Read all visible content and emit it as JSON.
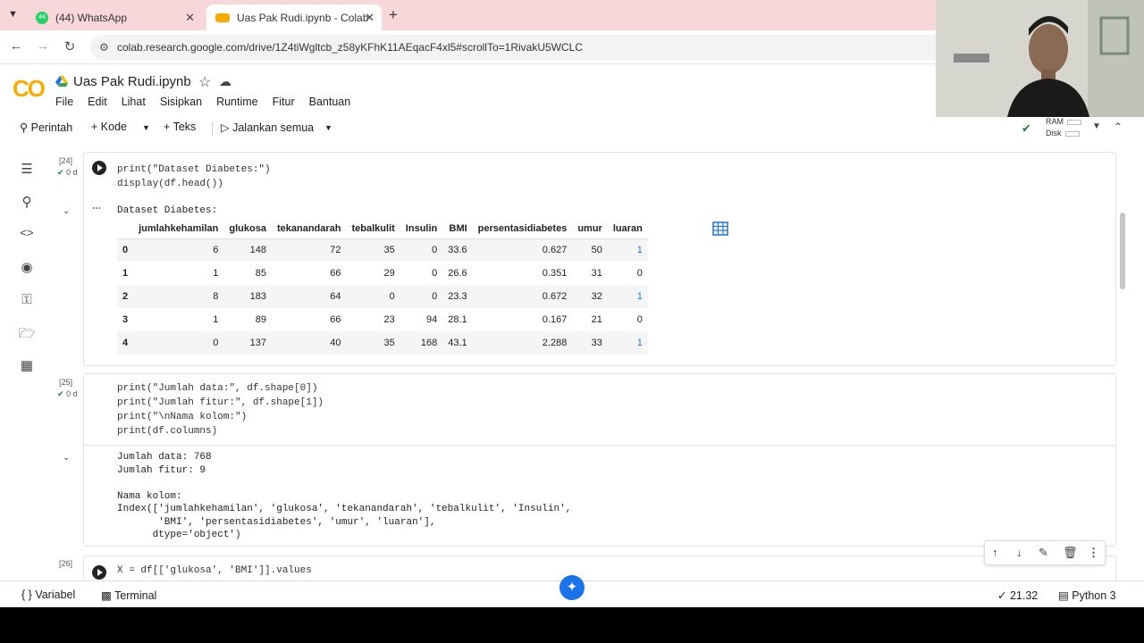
{
  "browser": {
    "tabs": [
      {
        "label": "(44) WhatsApp",
        "badge": "44",
        "active": false
      },
      {
        "label": "Uas Pak Rudi.ipynb - Colab",
        "active": true
      }
    ],
    "url": "colab.research.google.com/drive/1Z4tiWgltcb_z58yKFhK11AEqacF4xl5#scrollTo=1RivakU5WCLC"
  },
  "colab": {
    "logo": "CO",
    "title": "Uas Pak Rudi.ipynb",
    "menu": [
      "File",
      "Edit",
      "Lihat",
      "Sisipkan",
      "Runtime",
      "Fitur",
      "Bantuan"
    ],
    "toolbar": {
      "commands": "Perintah",
      "code": "Kode",
      "text": "Teks",
      "run_all": "Jalankan semua"
    },
    "resources": {
      "ram": "RAM",
      "disk": "Disk"
    }
  },
  "cells": [
    {
      "count": "[24]",
      "time": "0 d",
      "code": "print(\"Dataset Diabetes:\")\ndisplay(df.head())",
      "output_header": "Dataset Diabetes:",
      "table": {
        "columns": [
          "jumlahkehamilan",
          "glukosa",
          "tekanandarah",
          "tebalkulit",
          "Insulin",
          "BMI",
          "persentasidiabetes",
          "umur",
          "luaran"
        ],
        "rows": [
          [
            "0",
            "6",
            "148",
            "72",
            "35",
            "0",
            "33.6",
            "0.627",
            "50",
            "1"
          ],
          [
            "1",
            "1",
            "85",
            "66",
            "29",
            "0",
            "26.6",
            "0.351",
            "31",
            "0"
          ],
          [
            "2",
            "8",
            "183",
            "64",
            "0",
            "0",
            "23.3",
            "0.672",
            "32",
            "1"
          ],
          [
            "3",
            "1",
            "89",
            "66",
            "23",
            "94",
            "28.1",
            "0.167",
            "21",
            "0"
          ],
          [
            "4",
            "0",
            "137",
            "40",
            "35",
            "168",
            "43.1",
            "2.288",
            "33",
            "1"
          ]
        ]
      }
    },
    {
      "count": "[25]",
      "time": "0 d",
      "code": "print(\"Jumlah data:\", df.shape[0])\nprint(\"Jumlah fitur:\", df.shape[1])\nprint(\"\\nNama kolom:\")\nprint(df.columns)",
      "output": "Jumlah data: 768\nJumlah fitur: 9\n\nNama kolom:\nIndex(['jumlahkehamilan', 'glukosa', 'tekanandarah', 'tebalkulit', 'Insulin',\n       'BMI', 'persentasidiabetes', 'umur', 'luaran'],\n      dtype='object')"
    },
    {
      "count": "[26]",
      "code": "X = df[['glukosa', 'BMI']].values"
    }
  ],
  "statusbar": {
    "variables": "Variabel",
    "terminal": "Terminal",
    "time": "21.32",
    "runtime": "Python 3"
  },
  "colors": {
    "tab_strip": "#f8d7da",
    "accent": "#1a73e8",
    "ok": "#188038"
  }
}
